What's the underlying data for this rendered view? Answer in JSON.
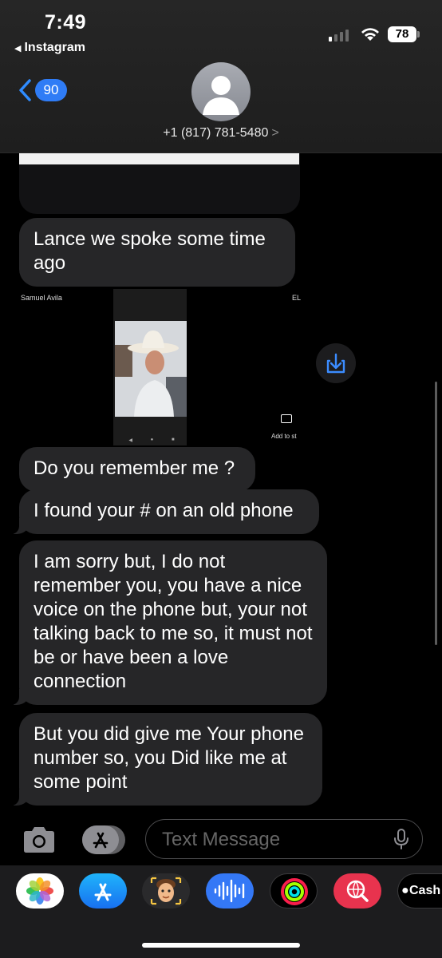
{
  "status_bar": {
    "time": "7:49",
    "back_app": "Instagram",
    "battery": "78"
  },
  "header": {
    "back_badge": "90",
    "contact": "+1 (817) 781-5480",
    "contact_chevron": ">"
  },
  "messages": [
    {
      "text": "Lance we spoke some time ago"
    },
    {
      "text": "Do you remember me ?"
    },
    {
      "text": "I found your # on an old phone"
    },
    {
      "text": "I am sorry but, I do not remember you, you have a nice voice on the phone but, your not talking back to me so, it must not be or have been a love connection"
    },
    {
      "text": "But you did give me Your phone number so, you Did like me at some point"
    }
  ],
  "screenshot_attachment": {
    "name": "Samuel Avila",
    "cut_label": "EL",
    "add_to_story": "Add to st"
  },
  "input": {
    "placeholder": "Text Message"
  },
  "app_drawer": {
    "apps": [
      "photos-app",
      "app-store",
      "memoji",
      "audio-message",
      "activity",
      "web-search",
      "apple-cash"
    ],
    "cash_label": "Cash"
  },
  "colors": {
    "accent": "#2f7cf6",
    "bubble": "#262628",
    "background": "#000000"
  }
}
